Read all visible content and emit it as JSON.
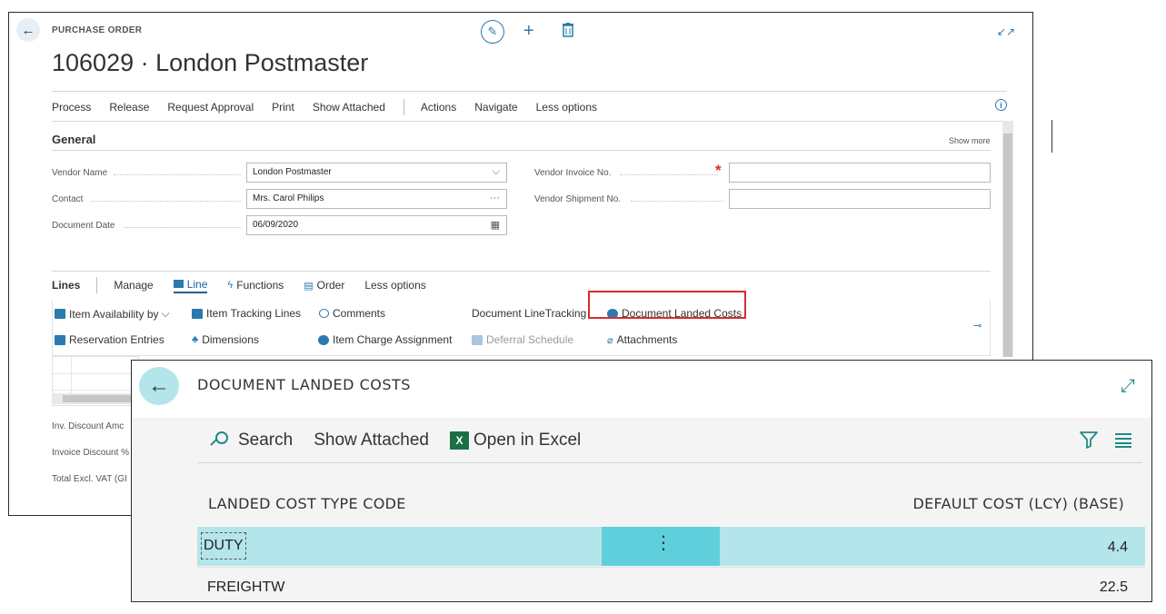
{
  "purchase_order": {
    "caption": "PURCHASE ORDER",
    "title": "106029 · London Postmaster",
    "menu": [
      "Process",
      "Release",
      "Request Approval",
      "Print",
      "Show Attached",
      "Actions",
      "Navigate",
      "Less options"
    ],
    "general": {
      "section_title": "General",
      "show_more": "Show more",
      "vendor_name_label": "Vendor Name",
      "vendor_name_value": "London Postmaster",
      "contact_label": "Contact",
      "contact_value": "Mrs. Carol Philips",
      "document_date_label": "Document Date",
      "document_date_value": "06/09/2020",
      "vendor_invoice_label": "Vendor Invoice No.",
      "vendor_invoice_value": "",
      "vendor_shipment_label": "Vendor Shipment No.",
      "vendor_shipment_value": ""
    },
    "lines": {
      "title": "Lines",
      "tabs": [
        "Manage",
        "Line",
        "Functions",
        "Order",
        "Less options"
      ],
      "active_tab": "Line",
      "actions": {
        "item_availability": "Item Availability by",
        "item_tracking_lines": "Item Tracking Lines",
        "comments": "Comments",
        "document_line_tracking": "Document LineTracking",
        "document_landed_costs": "Document Landed Costs",
        "reservation_entries": "Reservation Entries",
        "dimensions": "Dimensions",
        "item_charge_assignment": "Item Charge Assignment",
        "deferral_schedule": "Deferral Schedule",
        "attachments": "Attachments"
      }
    },
    "totals": {
      "inv_discount_amount": "Inv. Discount Amc",
      "invoice_discount_pct": "Invoice Discount %",
      "total_excl_vat": "Total Excl. VAT (GI"
    }
  },
  "landed_costs_dialog": {
    "title": "DOCUMENT LANDED COSTS",
    "toolbar": {
      "search": "Search",
      "show_attached": "Show Attached",
      "open_in_excel": "Open in Excel",
      "excel_icon_letter": "X"
    },
    "columns": {
      "code": "LANDED COST TYPE CODE",
      "cost": "DEFAULT COST (LCY) (BASE)"
    },
    "rows": [
      {
        "code": "DUTY",
        "cost": "4.4"
      },
      {
        "code": "FREIGHTW",
        "cost": "22.5"
      }
    ],
    "row_menu_glyph": "⋮"
  },
  "colors": {
    "accent": "#1f8a8a",
    "selected_row": "#b4e5eb",
    "selected_cell": "#5fd0db",
    "highlight_border": "#d92b2b",
    "link_blue": "#2a7ab0"
  }
}
